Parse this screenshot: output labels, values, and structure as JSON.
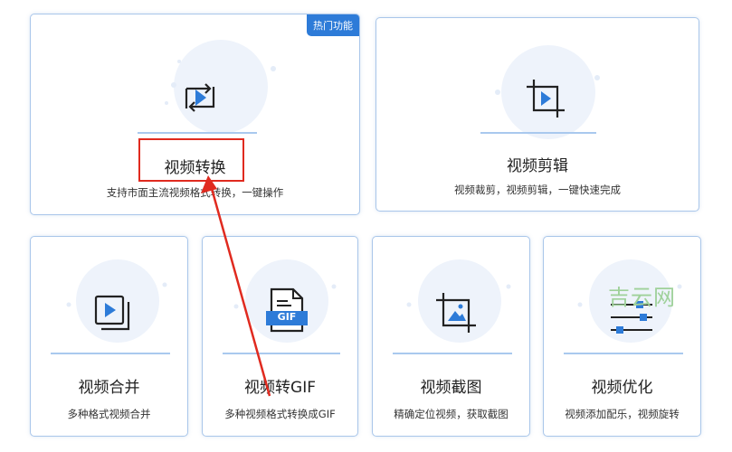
{
  "badge": "热门功能",
  "cards": [
    {
      "title": "视频转换",
      "desc": "支持市面主流视频格式转换，一键操作"
    },
    {
      "title": "视频剪辑",
      "desc": "视频裁剪，视频剪辑，一键快速完成"
    },
    {
      "title": "视频合并",
      "desc": "多种格式视频合并"
    },
    {
      "title": "视频转GIF",
      "desc": "多种视频格式转换成GIF"
    },
    {
      "title": "视频截图",
      "desc": "精确定位视频，获取截图"
    },
    {
      "title": "视频优化",
      "desc": "视频添加配乐，视频旋转"
    }
  ],
  "gif_label": "GIF",
  "watermark": "吉云网",
  "colors": {
    "accent": "#2d7bd8",
    "highlight": "#e02a1f",
    "icon": "#222222"
  }
}
